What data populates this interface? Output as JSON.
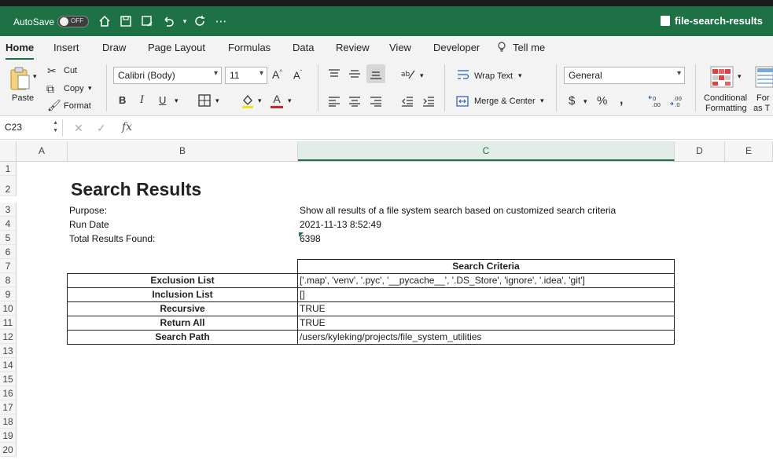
{
  "titlebar": {
    "autosave_label": "AutoSave",
    "autosave_state": "OFF",
    "file_name": "file-search-results"
  },
  "tabs": [
    {
      "label": "Home",
      "active": true
    },
    {
      "label": "Insert"
    },
    {
      "label": "Draw"
    },
    {
      "label": "Page Layout"
    },
    {
      "label": "Formulas"
    },
    {
      "label": "Data"
    },
    {
      "label": "Review"
    },
    {
      "label": "View"
    },
    {
      "label": "Developer"
    },
    {
      "label": "Tell me"
    }
  ],
  "ribbon": {
    "paste": "Paste",
    "cut": "Cut",
    "copy": "Copy",
    "format": "Format",
    "font_name": "Calibri (Body)",
    "font_size": "11",
    "wrap_text": "Wrap Text",
    "merge_center": "Merge & Center",
    "number_format": "General",
    "conditional": "Conditional",
    "formatting": "Formatting",
    "format_as_1": "For",
    "format_as_2": "as T"
  },
  "formula_bar": {
    "name_box": "C23",
    "fx": "fx",
    "content": ""
  },
  "columns": [
    "A",
    "B",
    "C",
    "D",
    "E"
  ],
  "row_numbers": [
    "1",
    "2",
    "3",
    "4",
    "5",
    "6",
    "7",
    "8",
    "9",
    "10",
    "11",
    "12",
    "13",
    "14",
    "15",
    "16",
    "17",
    "18",
    "19",
    "20"
  ],
  "sheet": {
    "title": "Search Results",
    "purpose_label": "Purpose:",
    "purpose_value": "Show all results of a file system search based on customized search criteria",
    "run_date_label": "Run Date",
    "run_date_value": "2021-11-13 8:52:49",
    "total_label": "Total Results Found:",
    "total_value": "6398",
    "criteria_header": "Search Criteria",
    "criteria": [
      {
        "label": "Exclusion List",
        "value": "['.map', 'venv', '.pyc', '__pycache__', '.DS_Store', 'ignore', '.idea', 'git']"
      },
      {
        "label": "Inclusion List",
        "value": "[]"
      },
      {
        "label": "Recursive",
        "value": "TRUE"
      },
      {
        "label": "Return All",
        "value": "TRUE"
      },
      {
        "label": "Search Path",
        "value": "/users/kyleking/projects/file_system_utilities"
      }
    ]
  },
  "colors": {
    "accent": "#1e7145"
  }
}
